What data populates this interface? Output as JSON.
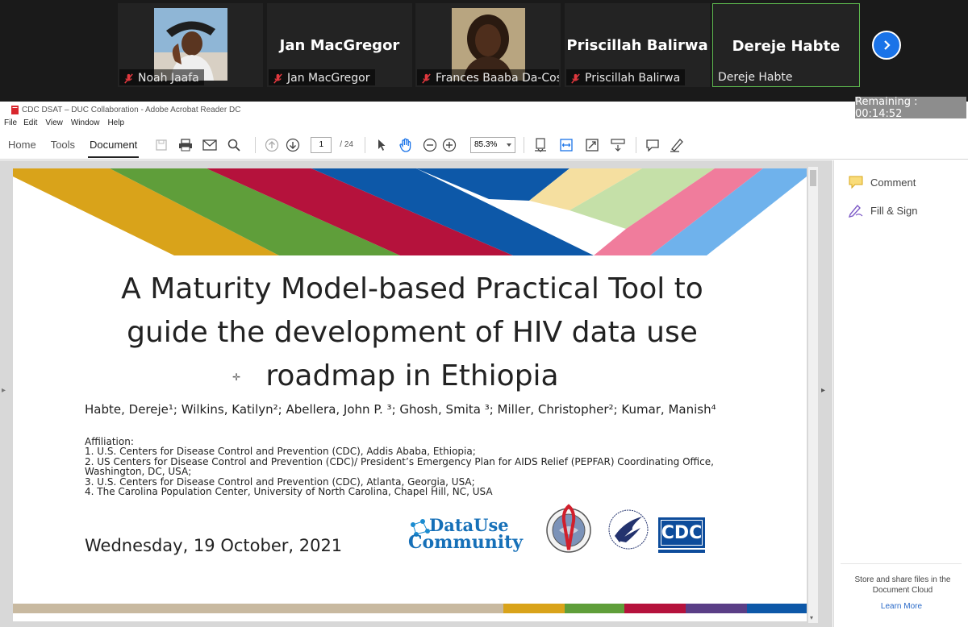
{
  "meeting": {
    "participants": [
      {
        "display_name": "",
        "caption": "Noah Jaafa",
        "muted": true
      },
      {
        "display_name": "Jan MacGregor",
        "caption": "Jan MacGregor",
        "muted": true
      },
      {
        "display_name": "",
        "caption": "Frances Baaba Da-Cost...",
        "muted": true
      },
      {
        "display_name": "Priscillah Balirwa",
        "caption": "Priscillah Balirwa",
        "muted": true
      },
      {
        "display_name": "Dereje Habte",
        "caption": "Dereje Habte",
        "muted": false
      }
    ],
    "remaining": "Remaining : 00:14:52",
    "colors": {
      "active_border": "#5db84e",
      "next_button": "#1a73e8",
      "muted_icon": "#e0383e"
    }
  },
  "window": {
    "title": "CDC DSAT – DUC Collaboration - Adobe Acrobat Reader DC"
  },
  "menu": [
    "File",
    "Edit",
    "View",
    "Window",
    "Help"
  ],
  "toolbar": {
    "tabs": [
      "Home",
      "Tools",
      "Document"
    ],
    "active_tab": "Document",
    "page_current": "1",
    "page_total": "/ 24",
    "zoom": "85.3%"
  },
  "slide": {
    "title_lines": [
      "A Maturity Model-based Practical Tool to",
      "guide the development of HIV data use",
      "roadmap in Ethiopia"
    ],
    "authors": "Habte, Dereje¹; Wilkins, Katilyn²; Abellera, John P. ³; Ghosh, Smita ³; Miller, Christopher²; Kumar, Manish⁴",
    "affiliation_heading": "Affiliation:",
    "affiliations": [
      "1. U.S. Centers for Disease Control and Prevention (CDC), Addis Ababa, Ethiopia;",
      "2. US Centers for Disease Control and Prevention (CDC)/ President’s Emergency Plan for AIDS Relief (PEPFAR) Coordinating Office, Washington, DC, USA;",
      "3. U.S. Centers for Disease Control and Prevention (CDC), Atlanta, Georgia, USA;",
      "4. The Carolina Population Center, University of North Carolina, Chapel Hill, NC, USA"
    ],
    "date": "Wednesday, 19 October, 2021",
    "logo_datause_line1": "DataUse",
    "logo_datause_line2": "Community",
    "logo_cdc": "CDC",
    "stripe_colors": [
      "#d9a31a",
      "#5f9e3a",
      "#b5123c",
      "#0d58a8",
      "#f5dfa0",
      "#c5e0a8",
      "#f07c9c",
      "#6fb2ec"
    ],
    "footer_colors": [
      "#c8b9a0",
      "#d9a31a",
      "#5f9e3a",
      "#b5123c",
      "#5a3e86",
      "#0d58a8"
    ]
  },
  "right_pane": {
    "comment": "Comment",
    "fill_sign": "Fill & Sign",
    "footer": "Store and share files in the Document Cloud",
    "learn_more": "Learn More"
  }
}
